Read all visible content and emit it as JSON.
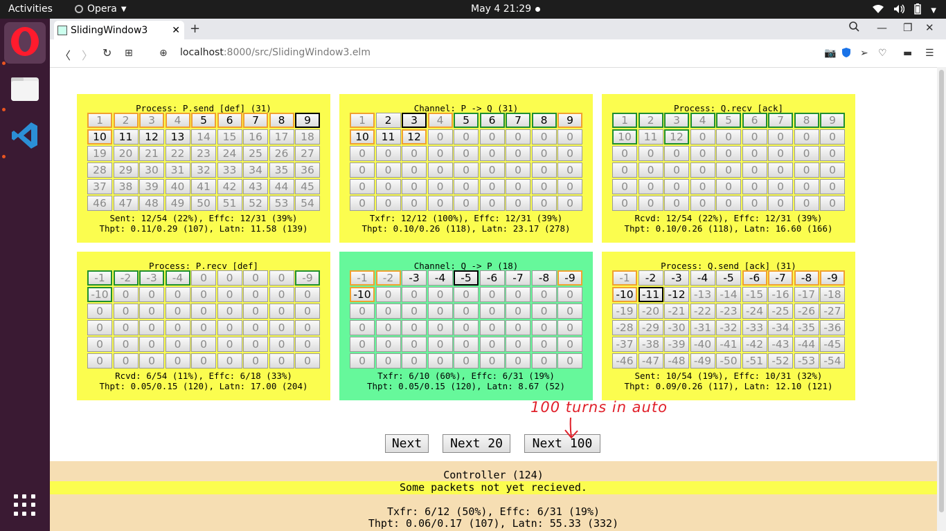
{
  "topbar": {
    "activities": "Activities",
    "app": "Opera",
    "clock": "May 4  21:29"
  },
  "browser": {
    "tab_title": "SlidingWindow3",
    "url_host": "localhost",
    "url_rest": ":8000/src/SlidingWindow3.elm"
  },
  "panels": [
    {
      "title": "Process: P.send [def] (31)",
      "style": "yellow",
      "stat1": "Sent: 12/54 (22%), Effc: 12/31 (39%)",
      "stat2": "Thpt: 0.11/0.29 (107), Latn: 11.58 (139)",
      "rows": [
        [
          "1",
          "2",
          "3",
          "4",
          "5",
          "6",
          "7",
          "8",
          "9"
        ],
        [
          "10",
          "11",
          "12",
          "13",
          "14",
          "15",
          "16",
          "17",
          "18"
        ],
        [
          "19",
          "20",
          "21",
          "22",
          "23",
          "24",
          "25",
          "26",
          "27"
        ],
        [
          "28",
          "29",
          "30",
          "31",
          "32",
          "33",
          "34",
          "35",
          "36"
        ],
        [
          "37",
          "38",
          "39",
          "40",
          "41",
          "42",
          "43",
          "44",
          "45"
        ],
        [
          "46",
          "47",
          "48",
          "49",
          "50",
          "51",
          "52",
          "53",
          "54"
        ]
      ],
      "cell_styles": [
        [
          "o",
          "o",
          "o",
          "o",
          "od",
          "od",
          "od",
          "od",
          "kd"
        ],
        [
          "od",
          "d",
          "d",
          "d",
          "",
          "",
          "",
          "",
          ""
        ],
        [
          "",
          "",
          "",
          "",
          "",
          "",
          "",
          "",
          ""
        ],
        [
          "",
          "",
          "",
          "",
          "",
          "",
          "",
          "",
          ""
        ],
        [
          "",
          "",
          "",
          "",
          "",
          "",
          "",
          "",
          ""
        ],
        [
          "",
          "",
          "",
          "",
          "",
          "",
          "",
          "",
          ""
        ]
      ]
    },
    {
      "title": "Channel: P -> Q (31)",
      "style": "yellow",
      "stat1": "Txfr: 12/12 (100%), Effc: 12/31 (39%)",
      "stat2": "Thpt: 0.10/0.26 (118), Latn: 23.17 (278)",
      "rows": [
        [
          "1",
          "2",
          "3",
          "4",
          "5",
          "6",
          "7",
          "8",
          "9"
        ],
        [
          "10",
          "11",
          "12",
          "0",
          "0",
          "0",
          "0",
          "0",
          "0"
        ],
        [
          "0",
          "0",
          "0",
          "0",
          "0",
          "0",
          "0",
          "0",
          "0"
        ],
        [
          "0",
          "0",
          "0",
          "0",
          "0",
          "0",
          "0",
          "0",
          "0"
        ],
        [
          "0",
          "0",
          "0",
          "0",
          "0",
          "0",
          "0",
          "0",
          "0"
        ],
        [
          "0",
          "0",
          "0",
          "0",
          "0",
          "0",
          "0",
          "0",
          "0"
        ]
      ],
      "cell_styles": [
        [
          "o",
          "d",
          "kd",
          "o",
          "gd",
          "gd",
          "gd",
          "gd",
          "od"
        ],
        [
          "od",
          "d",
          "od",
          "",
          "",
          "",
          "",
          "",
          ""
        ],
        [
          "",
          "",
          "",
          "",
          "",
          "",
          "",
          "",
          ""
        ],
        [
          "",
          "",
          "",
          "",
          "",
          "",
          "",
          "",
          ""
        ],
        [
          "",
          "",
          "",
          "",
          "",
          "",
          "",
          "",
          ""
        ],
        [
          "",
          "",
          "",
          "",
          "",
          "",
          "",
          "",
          ""
        ]
      ]
    },
    {
      "title": "Process: Q.recv [ack]",
      "style": "yellow",
      "stat1": "Rcvd: 12/54 (22%), Effc: 12/31 (39%)",
      "stat2": "Thpt: 0.10/0.26 (118), Latn: 16.60 (166)",
      "rows": [
        [
          "1",
          "2",
          "3",
          "4",
          "5",
          "6",
          "7",
          "8",
          "9"
        ],
        [
          "10",
          "11",
          "12",
          "0",
          "0",
          "0",
          "0",
          "0",
          "0"
        ],
        [
          "0",
          "0",
          "0",
          "0",
          "0",
          "0",
          "0",
          "0",
          "0"
        ],
        [
          "0",
          "0",
          "0",
          "0",
          "0",
          "0",
          "0",
          "0",
          "0"
        ],
        [
          "0",
          "0",
          "0",
          "0",
          "0",
          "0",
          "0",
          "0",
          "0"
        ],
        [
          "0",
          "0",
          "0",
          "0",
          "0",
          "0",
          "0",
          "0",
          "0"
        ]
      ],
      "cell_styles": [
        [
          "g",
          "g",
          "g",
          "g",
          "g",
          "g",
          "g",
          "g",
          "g"
        ],
        [
          "g",
          "",
          "g",
          "",
          "",
          "",
          "",
          "",
          ""
        ],
        [
          "",
          "",
          "",
          "",
          "",
          "",
          "",
          "",
          ""
        ],
        [
          "",
          "",
          "",
          "",
          "",
          "",
          "",
          "",
          ""
        ],
        [
          "",
          "",
          "",
          "",
          "",
          "",
          "",
          "",
          ""
        ],
        [
          "",
          "",
          "",
          "",
          "",
          "",
          "",
          "",
          ""
        ]
      ]
    },
    {
      "title": "Process: P.recv [def]",
      "style": "yellow",
      "stat1": "Rcvd: 6/54 (11%), Effc: 6/18 (33%)",
      "stat2": "Thpt: 0.05/0.15 (120), Latn: 17.00 (204)",
      "rows": [
        [
          "-1",
          "-2",
          "-3",
          "-4",
          "0",
          "0",
          "0",
          "0",
          "-9"
        ],
        [
          "-10",
          "0",
          "0",
          "0",
          "0",
          "0",
          "0",
          "0",
          "0"
        ],
        [
          "0",
          "0",
          "0",
          "0",
          "0",
          "0",
          "0",
          "0",
          "0"
        ],
        [
          "0",
          "0",
          "0",
          "0",
          "0",
          "0",
          "0",
          "0",
          "0"
        ],
        [
          "0",
          "0",
          "0",
          "0",
          "0",
          "0",
          "0",
          "0",
          "0"
        ],
        [
          "0",
          "0",
          "0",
          "0",
          "0",
          "0",
          "0",
          "0",
          "0"
        ]
      ],
      "cell_styles": [
        [
          "g",
          "g",
          "g",
          "g",
          "",
          "",
          "",
          "",
          "g"
        ],
        [
          "g",
          "",
          "",
          "",
          "",
          "",
          "",
          "",
          ""
        ],
        [
          "",
          "",
          "",
          "",
          "",
          "",
          "",
          "",
          ""
        ],
        [
          "",
          "",
          "",
          "",
          "",
          "",
          "",
          "",
          ""
        ],
        [
          "",
          "",
          "",
          "",
          "",
          "",
          "",
          "",
          ""
        ],
        [
          "",
          "",
          "",
          "",
          "",
          "",
          "",
          "",
          ""
        ]
      ]
    },
    {
      "title": "Channel: Q -> P (18)",
      "style": "green",
      "stat1": "Txfr: 6/10 (60%), Effc: 6/31 (19%)",
      "stat2": "Thpt: 0.05/0.15 (120), Latn: 8.67 (52)",
      "rows": [
        [
          "-1",
          "-2",
          "-3",
          "-4",
          "-5",
          "-6",
          "-7",
          "-8",
          "-9"
        ],
        [
          "-10",
          "0",
          "0",
          "0",
          "0",
          "0",
          "0",
          "0",
          "0"
        ],
        [
          "0",
          "0",
          "0",
          "0",
          "0",
          "0",
          "0",
          "0",
          "0"
        ],
        [
          "0",
          "0",
          "0",
          "0",
          "0",
          "0",
          "0",
          "0",
          "0"
        ],
        [
          "0",
          "0",
          "0",
          "0",
          "0",
          "0",
          "0",
          "0",
          "0"
        ],
        [
          "0",
          "0",
          "0",
          "0",
          "0",
          "0",
          "0",
          "0",
          "0"
        ]
      ],
      "cell_styles": [
        [
          "o",
          "o",
          "d",
          "d",
          "kd",
          "d",
          "d",
          "d",
          "od"
        ],
        [
          "od",
          "",
          "",
          "",
          "",
          "",
          "",
          "",
          ""
        ],
        [
          "",
          "",
          "",
          "",
          "",
          "",
          "",
          "",
          ""
        ],
        [
          "",
          "",
          "",
          "",
          "",
          "",
          "",
          "",
          ""
        ],
        [
          "",
          "",
          "",
          "",
          "",
          "",
          "",
          "",
          ""
        ],
        [
          "",
          "",
          "",
          "",
          "",
          "",
          "",
          "",
          ""
        ]
      ]
    },
    {
      "title": "Process: Q.send [ack] (31)",
      "style": "yellow",
      "stat1": "Sent: 10/54 (19%), Effc: 10/31 (32%)",
      "stat2": "Thpt: 0.09/0.26 (117), Latn: 12.10 (121)",
      "rows": [
        [
          "-1",
          "-2",
          "-3",
          "-4",
          "-5",
          "-6",
          "-7",
          "-8",
          "-9"
        ],
        [
          "-10",
          "-11",
          "-12",
          "-13",
          "-14",
          "-15",
          "-16",
          "-17",
          "-18"
        ],
        [
          "-19",
          "-20",
          "-21",
          "-22",
          "-23",
          "-24",
          "-25",
          "-26",
          "-27"
        ],
        [
          "-28",
          "-29",
          "-30",
          "-31",
          "-32",
          "-33",
          "-34",
          "-35",
          "-36"
        ],
        [
          "-37",
          "-38",
          "-39",
          "-40",
          "-41",
          "-42",
          "-43",
          "-44",
          "-45"
        ],
        [
          "-46",
          "-47",
          "-48",
          "-49",
          "-50",
          "-51",
          "-52",
          "-53",
          "-54"
        ]
      ],
      "cell_styles": [
        [
          "o",
          "d",
          "d",
          "d",
          "d",
          "od",
          "od",
          "od",
          "od"
        ],
        [
          "od",
          "kd",
          "d",
          "",
          "",
          "",
          "",
          "",
          ""
        ],
        [
          "",
          "",
          "",
          "",
          "",
          "",
          "",
          "",
          ""
        ],
        [
          "",
          "",
          "",
          "",
          "",
          "",
          "",
          "",
          ""
        ],
        [
          "",
          "",
          "",
          "",
          "",
          "",
          "",
          "",
          ""
        ],
        [
          "",
          "",
          "",
          "",
          "",
          "",
          "",
          "",
          ""
        ]
      ]
    }
  ],
  "buttons": {
    "next": "Next",
    "next20": "Next 20",
    "next100": "Next 100"
  },
  "annotation": "100 turns in auto",
  "controller": {
    "title": "Controller (124)",
    "warning": "Some packets not yet recieved.",
    "stat1": "Txfr: 6/12 (50%), Effc: 6/31 (19%)",
    "stat2": "Thpt: 0.06/0.17 (107), Latn: 55.33 (332)"
  }
}
